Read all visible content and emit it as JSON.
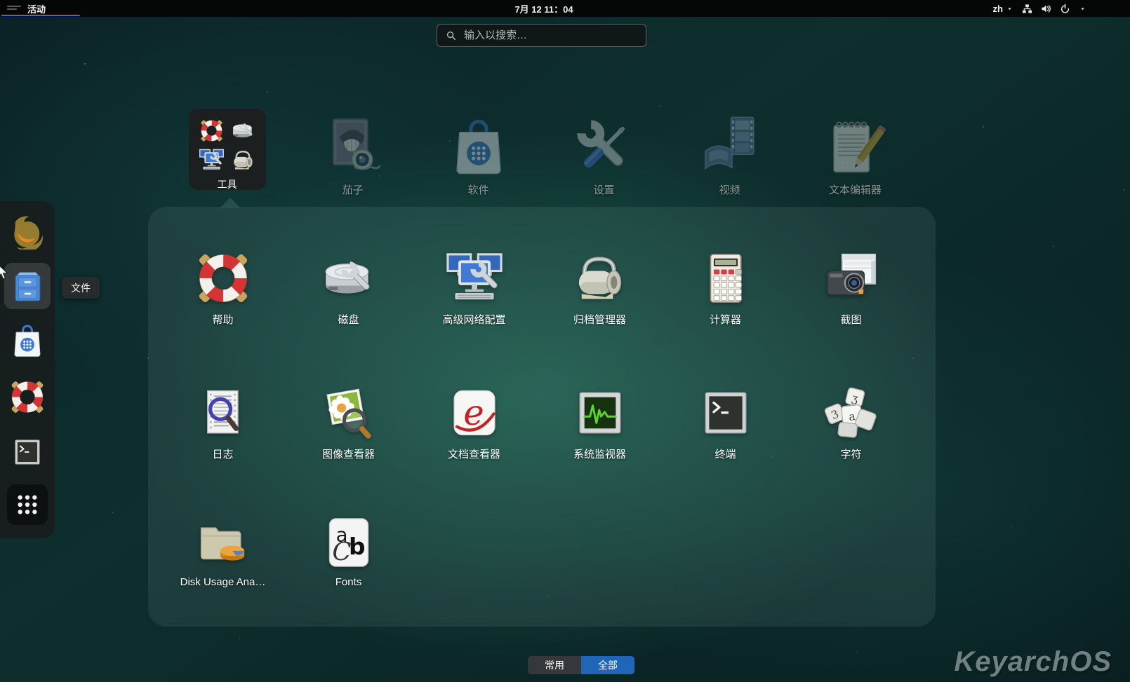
{
  "topbar": {
    "activities_label": "活动",
    "clock": "7月 12 11：04",
    "language": "zh",
    "right_icons": [
      "keyboard-language-selector",
      "caret-down",
      "network-wired",
      "volume",
      "power",
      "caret-down"
    ]
  },
  "search": {
    "placeholder": "输入以搜索…"
  },
  "app_categories_row": [
    {
      "label": "工具",
      "icon": "tools-folder",
      "selected": true,
      "mini_icons": [
        "lifebuoy",
        "disk-wrench",
        "monitors-wrench",
        "archive-roller"
      ]
    },
    {
      "label": "茄子",
      "icon": "cheese-webcam",
      "selected": false
    },
    {
      "label": "软件",
      "icon": "software-bag",
      "selected": false
    },
    {
      "label": "设置",
      "icon": "settings-tools",
      "selected": false
    },
    {
      "label": "视频",
      "icon": "videos-filmstrip",
      "selected": false
    },
    {
      "label": "文本编辑器",
      "icon": "notepad-pencil",
      "selected": false
    }
  ],
  "folder_apps": [
    {
      "label": "帮助",
      "icon": "lifebuoy"
    },
    {
      "label": "磁盘",
      "icon": "disk-wrench"
    },
    {
      "label": "高级网络配置",
      "icon": "monitors-wrench"
    },
    {
      "label": "归档管理器",
      "icon": "archive-roller"
    },
    {
      "label": "计算器",
      "icon": "calculator"
    },
    {
      "label": "截图",
      "icon": "camera-window"
    },
    {
      "label": "日志",
      "icon": "document-magnifier"
    },
    {
      "label": "图像查看器",
      "icon": "photo-magnifier"
    },
    {
      "label": "文档查看器",
      "icon": "evince-e"
    },
    {
      "label": "系统监视器",
      "icon": "waveform-monitor"
    },
    {
      "label": "终端",
      "icon": "terminal"
    },
    {
      "label": "字符",
      "icon": "keycaps"
    },
    {
      "label": "Disk Usage Ana…",
      "icon": "folder-piechart"
    },
    {
      "label": "Fonts",
      "icon": "fonts-acb"
    }
  ],
  "dock": {
    "tooltip": "文件",
    "items": [
      {
        "name": "firefox",
        "icon": "firefox"
      },
      {
        "name": "files",
        "icon": "file-cabinet",
        "hovered": true
      },
      {
        "name": "software",
        "icon": "software-bag"
      },
      {
        "name": "help",
        "icon": "lifebuoy"
      },
      {
        "name": "terminal",
        "icon": "terminal"
      },
      {
        "name": "app-grid",
        "icon": "grid-9-dots",
        "active": true
      }
    ]
  },
  "footer": {
    "frequent_label": "常用",
    "all_label": "全部",
    "selected": "全部"
  },
  "watermark": "KeyarchOS",
  "colors": {
    "accent_blue": "#1f66b8",
    "activities_underline": "#2d76cc",
    "topbar_bg": "#050606",
    "dock_bg": "rgba(26,28,28,0.86)",
    "popup_bg": "rgba(170,205,200,0.10)",
    "frequent_button_bg": "#34383a"
  }
}
